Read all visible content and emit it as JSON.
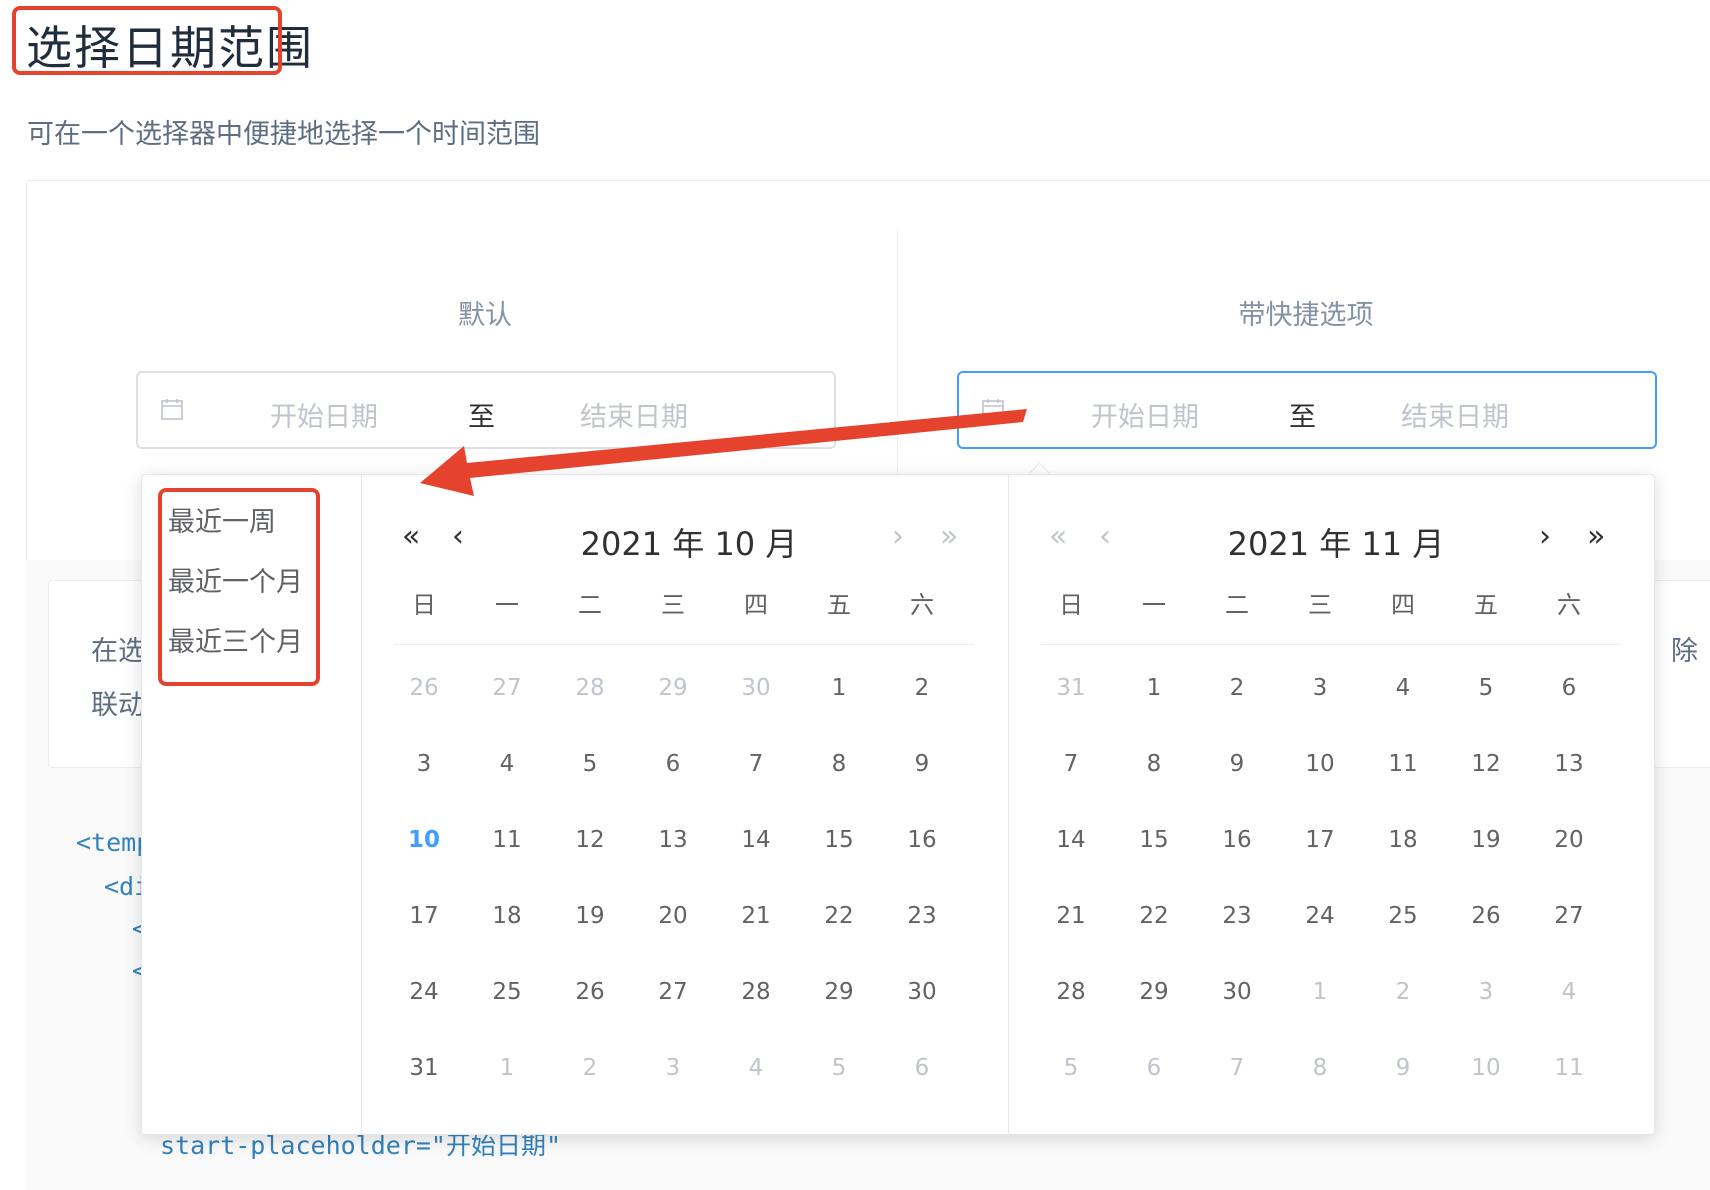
{
  "page": {
    "title": "选择日期范围",
    "description": "可在一个选择器中便捷地选择一个时间范围"
  },
  "demo": {
    "default_title": "默认",
    "shortcut_title": "带快捷选项"
  },
  "range_input_default": {
    "start_placeholder": "开始日期",
    "separator": "至",
    "end_placeholder": "结束日期"
  },
  "range_input_shortcut": {
    "start_placeholder": "开始日期",
    "separator": "至",
    "end_placeholder": "结束日期"
  },
  "shortcuts": [
    "最近一周",
    "最近一个月",
    "最近三个月"
  ],
  "desc_fragments": {
    "line1_start": "在选",
    "line2_start": "联动",
    "line1_end": "除"
  },
  "code_fragments": {
    "line1": "<temp",
    "line2": "<di",
    "line3": "<",
    "line4": "<",
    "bottom": "start-placeholder=\"开始日期\""
  },
  "weekdays": [
    "日",
    "一",
    "二",
    "三",
    "四",
    "五",
    "六"
  ],
  "left_panel": {
    "title": "2021 年 10 月",
    "days": [
      [
        "26",
        "27",
        "28",
        "29",
        "30",
        "1",
        "2"
      ],
      [
        "3",
        "4",
        "5",
        "6",
        "7",
        "8",
        "9"
      ],
      [
        "10",
        "11",
        "12",
        "13",
        "14",
        "15",
        "16"
      ],
      [
        "17",
        "18",
        "19",
        "20",
        "21",
        "22",
        "23"
      ],
      [
        "24",
        "25",
        "26",
        "27",
        "28",
        "29",
        "30"
      ],
      [
        "31",
        "1",
        "2",
        "3",
        "4",
        "5",
        "6"
      ]
    ],
    "first_in_month_index": 5,
    "last_in_month_index": 35,
    "today_index": 14
  },
  "right_panel": {
    "title": "2021 年 11 月",
    "days": [
      [
        "31",
        "1",
        "2",
        "3",
        "4",
        "5",
        "6"
      ],
      [
        "7",
        "8",
        "9",
        "10",
        "11",
        "12",
        "13"
      ],
      [
        "14",
        "15",
        "16",
        "17",
        "18",
        "19",
        "20"
      ],
      [
        "21",
        "22",
        "23",
        "24",
        "25",
        "26",
        "27"
      ],
      [
        "28",
        "29",
        "30",
        "1",
        "2",
        "3",
        "4"
      ],
      [
        "5",
        "6",
        "7",
        "8",
        "9",
        "10",
        "11"
      ]
    ],
    "first_in_month_index": 1,
    "last_in_month_index": 30,
    "today_index": -1
  },
  "nav_icons": {
    "prev_year": "«",
    "prev_month": "‹",
    "next_month": "›",
    "next_year": "»"
  },
  "colors": {
    "highlight": "#e5432d",
    "primary": "#409eff",
    "muted": "#c0c4cc"
  }
}
